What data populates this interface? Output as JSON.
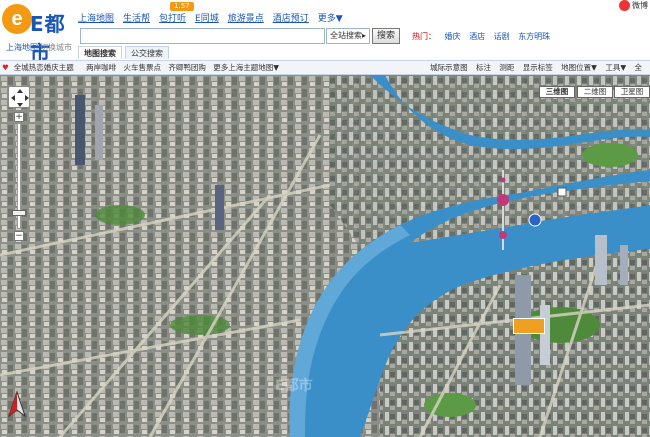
{
  "logo": {
    "brand": "E都市",
    "region": "上海地图",
    "switch_city": "切换城市"
  },
  "nav": {
    "items": [
      "上海地图",
      "生活帮",
      "包打听",
      "E同城",
      "旅游景点",
      "酒店预订"
    ],
    "more": "更多▼",
    "badge": "1.57"
  },
  "weibo": {
    "label": "微博"
  },
  "search": {
    "value": "",
    "select_label": "全站搜索▸",
    "button": "搜索"
  },
  "hot": {
    "label": "热门：",
    "items": [
      "婚庆",
      "酒店",
      "话剧",
      "东方明珠"
    ]
  },
  "tabs": [
    "地图搜索",
    "公交搜索"
  ],
  "toolbar_left": [
    "全城热恋婚庆主题",
    "两岸咖啡",
    "火车售票点",
    "齐卿鸭团购",
    "更多上海主题地图▼"
  ],
  "toolbar_right": [
    "城际示意图",
    "标注",
    "测距",
    "显示标签",
    "地图位置▼",
    "工具▼",
    "全"
  ],
  "map_types": [
    "三维图",
    "二维图",
    "卫星图"
  ],
  "map_types_active": "三维图",
  "colors": {
    "accent": "#1a56b6",
    "river": "#3a8fc8",
    "city": "#8a8f85",
    "green": "#4e8a3a",
    "highlight": "#f39a12"
  },
  "watermark": "E都市",
  "zoom": {
    "in": "+",
    "out": "−"
  }
}
